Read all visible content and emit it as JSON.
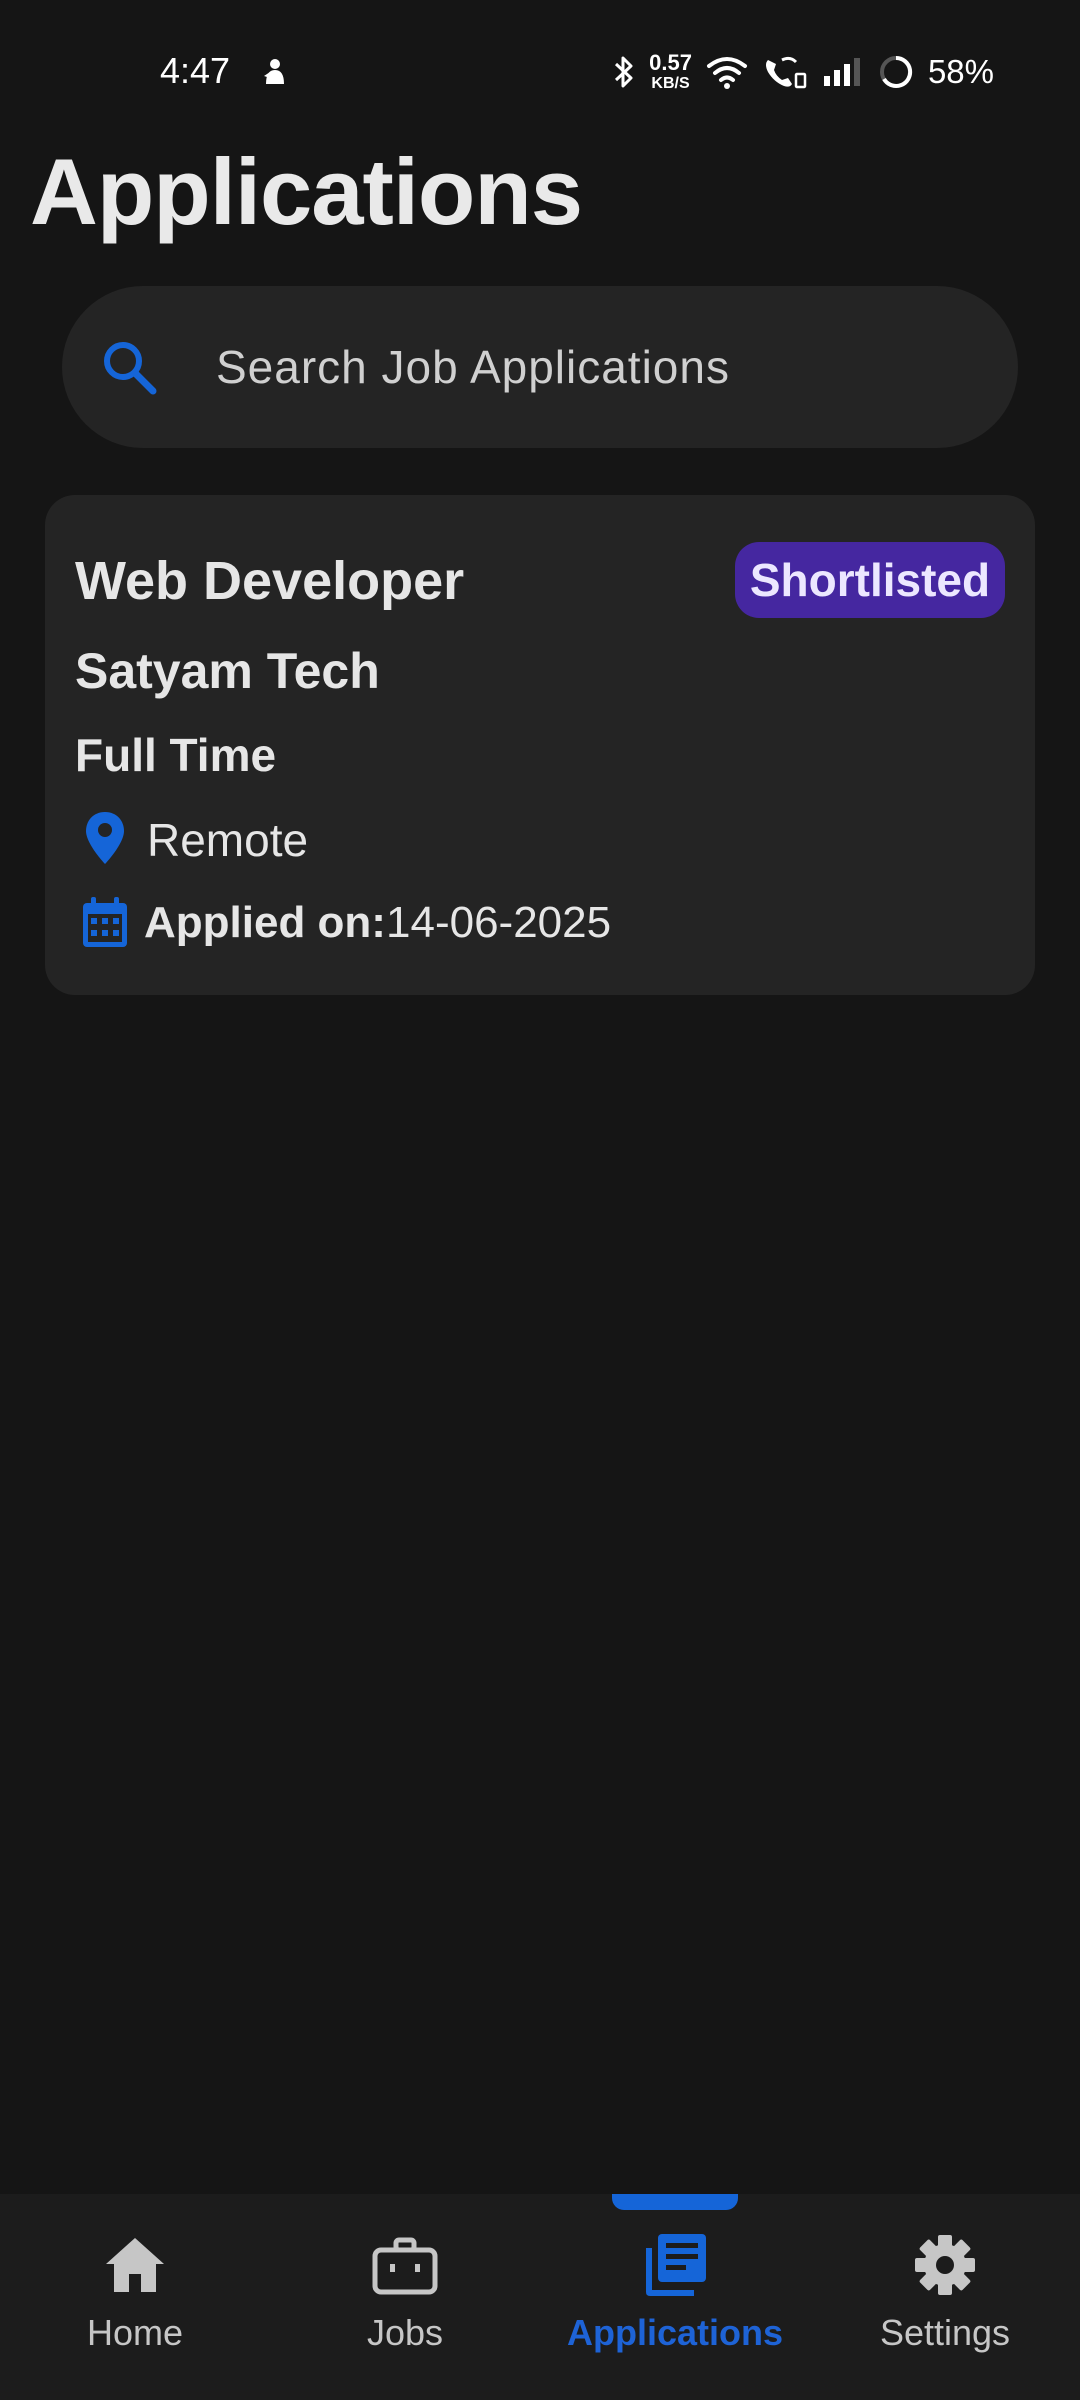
{
  "status_bar": {
    "time": "4:47",
    "net_speed_value": "0.57",
    "net_speed_unit": "KB/S",
    "battery": "58%"
  },
  "page": {
    "title": "Applications"
  },
  "search": {
    "placeholder": "Search Job Applications",
    "icon": "search-icon"
  },
  "applications": [
    {
      "job_title": "Web Developer",
      "status": "Shortlisted",
      "company": "Satyam Tech",
      "job_type": "Full Time",
      "location": "Remote",
      "applied_label": "Applied on:",
      "applied_date": "14-06-2025"
    }
  ],
  "bottom_nav": {
    "items": [
      {
        "label": "Home",
        "icon": "home-icon",
        "active": false
      },
      {
        "label": "Jobs",
        "icon": "briefcase-icon",
        "active": false
      },
      {
        "label": "Applications",
        "icon": "newspaper-icon",
        "active": true
      },
      {
        "label": "Settings",
        "icon": "gear-icon",
        "active": false
      }
    ]
  },
  "colors": {
    "background": "#151515",
    "surface": "#242424",
    "accent": "#1565d8",
    "badge": "#4527a0",
    "text": "#e6e6e6"
  }
}
